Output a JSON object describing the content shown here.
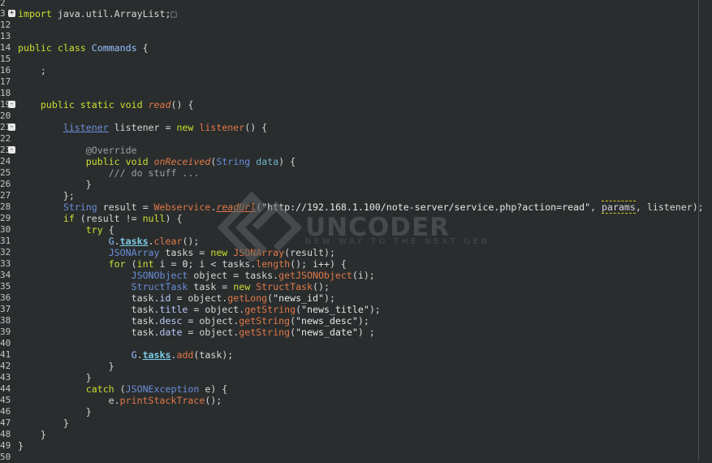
{
  "line_numbers": [
    "2",
    "3",
    "12",
    "13",
    "14",
    "15",
    "16",
    "17",
    "18",
    "19",
    "20",
    "21",
    "22",
    "23",
    "24",
    "25",
    "26",
    "27",
    "28",
    "29",
    "30",
    "31",
    "32",
    "33",
    "34",
    "35",
    "36",
    "37",
    "38",
    "39",
    "40",
    "41",
    "42",
    "43",
    "44",
    "45",
    "46",
    "47",
    "48",
    "49",
    "50"
  ],
  "folded_marker": "□",
  "watermark": {
    "name": "UNCODER",
    "tagline": "NEW WAY TO THE NEXT GEN"
  },
  "lines": [
    [],
    [
      [
        "kw",
        "import"
      ],
      [
        "pl",
        " java.util.ArrayList;"
      ]
    ],
    [],
    [],
    [
      [
        "kw",
        "public"
      ],
      [
        "pl",
        " "
      ],
      [
        "kw",
        "class"
      ],
      [
        "pl",
        " "
      ],
      [
        "cls",
        "Commands"
      ],
      [
        "pl",
        " {"
      ]
    ],
    [],
    [
      [
        "pl",
        "    ;"
      ]
    ],
    [],
    [],
    [
      [
        "pl",
        "    "
      ],
      [
        "kw",
        "public"
      ],
      [
        "pl",
        " "
      ],
      [
        "kw",
        "static"
      ],
      [
        "pl",
        " "
      ],
      [
        "kw",
        "void"
      ],
      [
        "pl",
        " "
      ],
      [
        "fn",
        "read"
      ],
      [
        "pl",
        "() {"
      ]
    ],
    [],
    [
      [
        "pl",
        "        "
      ],
      [
        "tyu",
        "listener"
      ],
      [
        "pl",
        " listener = "
      ],
      [
        "kw",
        "new"
      ],
      [
        "pl",
        " "
      ],
      [
        "mc",
        "listener"
      ],
      [
        "pl",
        "() {"
      ]
    ],
    [],
    [
      [
        "pl",
        "            "
      ],
      [
        "an",
        "@Override"
      ]
    ],
    [
      [
        "pl",
        "            "
      ],
      [
        "kw",
        "public"
      ],
      [
        "pl",
        " "
      ],
      [
        "kw",
        "void"
      ],
      [
        "pl",
        " "
      ],
      [
        "fn",
        "onReceived"
      ],
      [
        "pl",
        "("
      ],
      [
        "ty",
        "String"
      ],
      [
        "pl",
        " "
      ],
      [
        "pvar",
        "data"
      ],
      [
        "pl",
        ") {"
      ]
    ],
    [
      [
        "pl",
        "                "
      ],
      [
        "cm",
        "/// do stuff ..."
      ]
    ],
    [
      [
        "pl",
        "            }"
      ]
    ],
    [
      [
        "pl",
        "        };"
      ]
    ],
    [
      [
        "pl",
        "        "
      ],
      [
        "ty",
        "String"
      ],
      [
        "pl",
        " result = "
      ],
      [
        "mc",
        "Webservice"
      ],
      [
        "pl",
        "."
      ],
      [
        "fnr",
        "readUrl"
      ],
      [
        "pl",
        "("
      ],
      [
        "st",
        "\"http://192.168.1.100/note-server/service.php?action=read\""
      ],
      [
        "pl",
        ", "
      ],
      [
        "warn",
        "params"
      ],
      [
        "pl",
        ", listener);"
      ]
    ],
    [
      [
        "pl",
        "        "
      ],
      [
        "kw",
        "if"
      ],
      [
        "pl",
        " (result != "
      ],
      [
        "kw",
        "null"
      ],
      [
        "pl",
        ") {"
      ]
    ],
    [
      [
        "pl",
        "            "
      ],
      [
        "kw",
        "try"
      ],
      [
        "pl",
        " {"
      ]
    ],
    [
      [
        "pl",
        "                "
      ],
      [
        "cls",
        "G"
      ],
      [
        "pl",
        "."
      ],
      [
        "sf",
        "tasks"
      ],
      [
        "pl",
        "."
      ],
      [
        "mc",
        "clear"
      ],
      [
        "pl",
        "();"
      ]
    ],
    [
      [
        "pl",
        "                "
      ],
      [
        "ty",
        "JSONArray"
      ],
      [
        "pl",
        " tasks = "
      ],
      [
        "kw",
        "new"
      ],
      [
        "pl",
        " "
      ],
      [
        "mc",
        "JSONArray"
      ],
      [
        "pl",
        "(result);"
      ]
    ],
    [
      [
        "pl",
        "                "
      ],
      [
        "kw",
        "for"
      ],
      [
        "pl",
        " ("
      ],
      [
        "kw",
        "int"
      ],
      [
        "pl",
        " i = "
      ],
      [
        "num",
        "0"
      ],
      [
        "pl",
        "; i < tasks."
      ],
      [
        "mc",
        "length"
      ],
      [
        "pl",
        "(); i++) {"
      ]
    ],
    [
      [
        "pl",
        "                    "
      ],
      [
        "ty",
        "JSONObject"
      ],
      [
        "pl",
        " object = tasks."
      ],
      [
        "mc",
        "getJSONObject"
      ],
      [
        "pl",
        "(i);"
      ]
    ],
    [
      [
        "pl",
        "                    "
      ],
      [
        "ty",
        "StructTask"
      ],
      [
        "pl",
        " task = "
      ],
      [
        "kw",
        "new"
      ],
      [
        "pl",
        " "
      ],
      [
        "mc",
        "StructTask"
      ],
      [
        "pl",
        "();"
      ]
    ],
    [
      [
        "pl",
        "                    task."
      ],
      [
        "fld",
        "id"
      ],
      [
        "pl",
        " = object."
      ],
      [
        "mc",
        "getLong"
      ],
      [
        "pl",
        "("
      ],
      [
        "st",
        "\"news_id\""
      ],
      [
        "pl",
        ");"
      ]
    ],
    [
      [
        "pl",
        "                    task."
      ],
      [
        "fld",
        "title"
      ],
      [
        "pl",
        " = object."
      ],
      [
        "mc",
        "getString"
      ],
      [
        "pl",
        "("
      ],
      [
        "st",
        "\"news_title\""
      ],
      [
        "pl",
        ");"
      ]
    ],
    [
      [
        "pl",
        "                    task."
      ],
      [
        "fld",
        "desc"
      ],
      [
        "pl",
        " = object."
      ],
      [
        "mc",
        "getString"
      ],
      [
        "pl",
        "("
      ],
      [
        "st",
        "\"news_desc\""
      ],
      [
        "pl",
        ");"
      ]
    ],
    [
      [
        "pl",
        "                    task."
      ],
      [
        "fld",
        "date"
      ],
      [
        "pl",
        " = object."
      ],
      [
        "mc",
        "getString"
      ],
      [
        "pl",
        "("
      ],
      [
        "st",
        "\"news_date\""
      ],
      [
        "pl",
        ") ;"
      ]
    ],
    [],
    [
      [
        "pl",
        "                    "
      ],
      [
        "cls",
        "G"
      ],
      [
        "pl",
        "."
      ],
      [
        "sf",
        "tasks"
      ],
      [
        "pl",
        "."
      ],
      [
        "mc",
        "add"
      ],
      [
        "pl",
        "(task);"
      ]
    ],
    [
      [
        "pl",
        "                }"
      ]
    ],
    [
      [
        "pl",
        "            }"
      ]
    ],
    [
      [
        "pl",
        "            "
      ],
      [
        "kw",
        "catch"
      ],
      [
        "pl",
        " ("
      ],
      [
        "ty",
        "JSONException"
      ],
      [
        "pl",
        " e) {"
      ]
    ],
    [
      [
        "pl",
        "                e."
      ],
      [
        "mc",
        "printStackTrace"
      ],
      [
        "pl",
        "();"
      ]
    ],
    [
      [
        "pl",
        "            }"
      ]
    ],
    [
      [
        "pl",
        "        }"
      ]
    ],
    [
      [
        "pl",
        "    }"
      ]
    ],
    [
      [
        "pl",
        "}"
      ]
    ],
    []
  ]
}
